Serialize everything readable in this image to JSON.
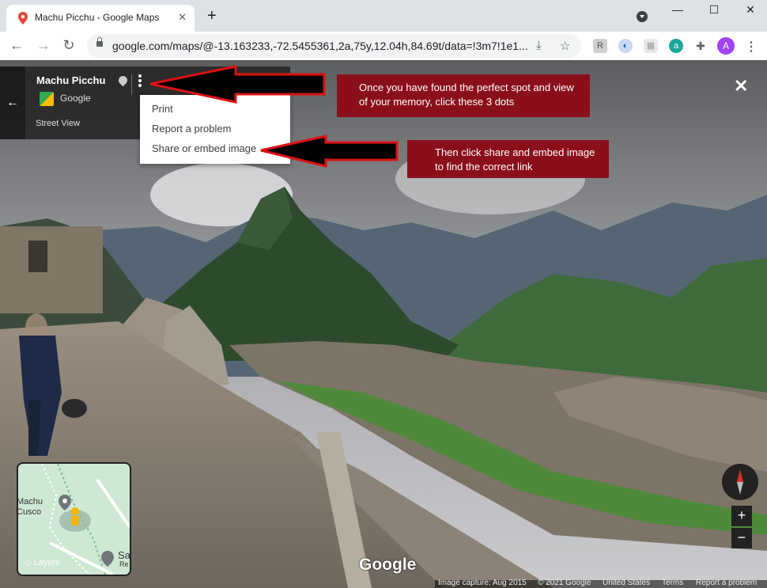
{
  "browser": {
    "tab_title": "Machu Picchu - Google Maps",
    "tab_close": "✕",
    "new_tab": "+",
    "url": "google.com/maps/@-13.163233,-72.5455361,2a,75y,12.04h,84.69t/data=!3m7!1e1...",
    "window_controls": {
      "minimize": "—",
      "maximize": "☐",
      "close": "✕"
    },
    "nav": {
      "back": "←",
      "forward": "→",
      "reload": "↻"
    },
    "omnibox_icons": [
      "install-icon",
      "star-icon"
    ],
    "extensions": [
      "ext-r-icon",
      "ext-shield-icon",
      "ext-grid-icon",
      "ext-a-icon",
      "puzzle-icon"
    ],
    "profile_initial": "A",
    "menu_glyph": "⋮"
  },
  "place_card": {
    "name": "Machu Picchu",
    "source": "Google",
    "mode": "Street View",
    "back_glyph": "←"
  },
  "menu": {
    "items": [
      "Print",
      "Report a problem",
      "Share or embed image"
    ]
  },
  "annotations": {
    "note1": "Once you have found the perfect spot and view of your memory, click these 3 dots",
    "note2": "Then click share and embed image to find the correct link",
    "accent": "#8b0f1a"
  },
  "close_glyph": "✕",
  "minimap": {
    "labels": [
      "Machu",
      "Cusco",
      "Sa",
      "Re"
    ],
    "layers_label": "Layers"
  },
  "watermark": "Google",
  "footer": {
    "capture": "Image capture: Aug 2015",
    "copyright": "© 2021 Google",
    "country": "United States",
    "terms": "Terms",
    "report": "Report a problem"
  },
  "controls": {
    "zoom_in": "+",
    "zoom_out": "−"
  }
}
